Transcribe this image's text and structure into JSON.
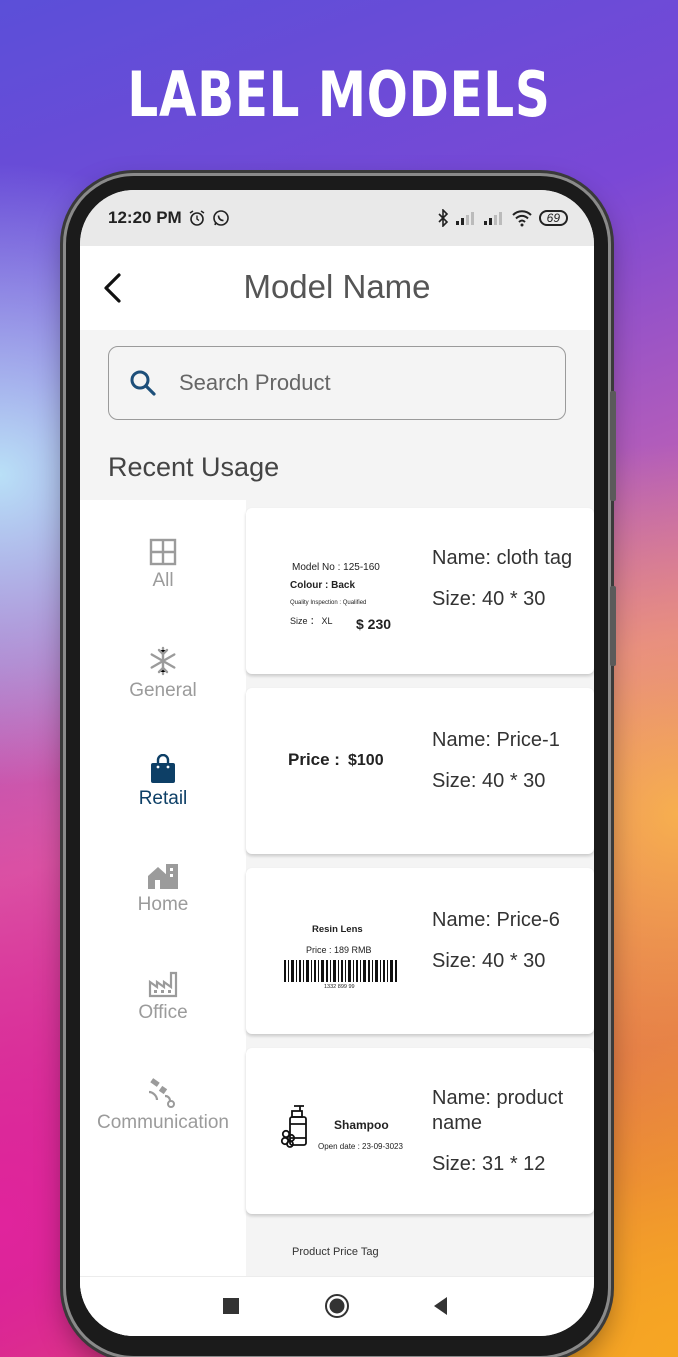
{
  "headline": "LABEL MODELS",
  "status": {
    "time": "12:20 PM",
    "battery": "69"
  },
  "appbar": {
    "back_glyph": "‹",
    "title": "Model Name"
  },
  "search": {
    "placeholder": "Search Product"
  },
  "recent_title": "Recent Usage",
  "categories": [
    {
      "label": "All",
      "icon": "grid-icon",
      "active": false
    },
    {
      "label": "General",
      "icon": "snowflake-icon",
      "active": false
    },
    {
      "label": "Retail",
      "icon": "shopping-bag-icon",
      "active": true
    },
    {
      "label": "Home",
      "icon": "home-icon",
      "active": false
    },
    {
      "label": "Office",
      "icon": "factory-icon",
      "active": false
    },
    {
      "label": "Communication",
      "icon": "satellite-icon",
      "active": false
    }
  ],
  "cards": [
    {
      "name": "Name: cloth tag",
      "size": "Size: 40 * 30",
      "preview": {
        "model_no": "Model No : 125-160",
        "colour": "Colour : Back",
        "quality": "Quality Inspection : Qualified",
        "size": "Size ： XL",
        "price": "$ 230"
      }
    },
    {
      "name": "Name: Price-1",
      "size": "Size: 40 * 30",
      "preview": {
        "price_label": "Price :",
        "price_value": "$100"
      }
    },
    {
      "name": "Name: Price-6",
      "size": "Size: 40 * 30",
      "preview": {
        "title": "Resin Lens",
        "price": "Price : 189 RMB",
        "barcode_number": "1332 899 99"
      }
    },
    {
      "name": "Name: product name",
      "size": "Size: 31 * 12",
      "preview": {
        "title": "Shampoo",
        "open_date": "Open date : 23-09-3023"
      }
    }
  ],
  "partial_card_title": "Product Price Tag",
  "colors": {
    "accent": "#0d3f66",
    "inactive": "#9b9b9b",
    "search_icon": "#1d4f7a"
  }
}
